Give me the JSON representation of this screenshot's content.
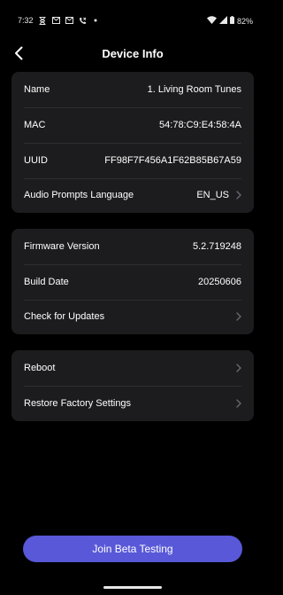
{
  "status_bar": {
    "time": "7:32",
    "battery": "82%",
    "left_icons": [
      "hourglass-icon",
      "mail-icon",
      "mail-icon",
      "phone-missed-icon",
      "dot-icon"
    ],
    "right_icons": [
      "wifi-icon",
      "signal-icon",
      "battery-icon"
    ]
  },
  "header": {
    "title": "Device Info",
    "back_icon": "chevron-left-icon"
  },
  "device_card": {
    "rows": [
      {
        "label": "Name",
        "value": "1. Living Room Tunes"
      },
      {
        "label": "MAC",
        "value": "54:78:C9:E4:58:4A"
      },
      {
        "label": "UUID",
        "value": "FF98F7F456A1F62B85B67A59"
      },
      {
        "label": "Audio Prompts Language",
        "value": "EN_US"
      }
    ]
  },
  "firmware_card": {
    "rows": [
      {
        "label": "Firmware Version",
        "value": "5.2.719248"
      },
      {
        "label": "Build Date",
        "value": "20250606"
      },
      {
        "label": "Check for Updates"
      }
    ]
  },
  "system_card": {
    "rows": [
      {
        "label": "Reboot"
      },
      {
        "label": "Restore Factory Settings"
      }
    ]
  },
  "beta_button": {
    "label": "Join Beta Testing"
  },
  "colors": {
    "background": "#000000",
    "card": "#1c1c1e",
    "divider": "#2e2e31",
    "accent": "#5858d8",
    "chevron": "#6b6b70"
  }
}
